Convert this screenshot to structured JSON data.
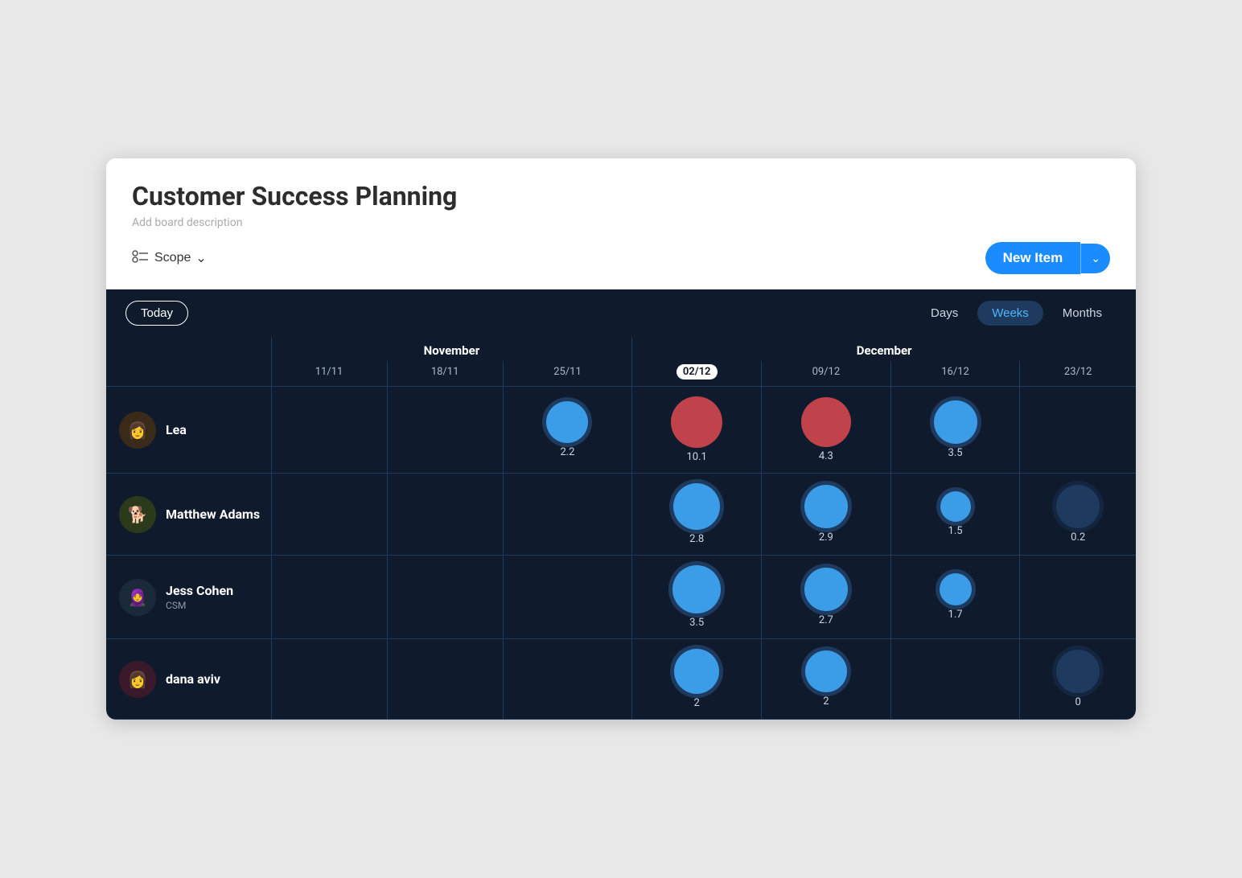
{
  "header": {
    "title": "Customer Success Planning",
    "description": "Add board description",
    "scope_label": "Scope",
    "new_item_label": "New Item"
  },
  "timeline": {
    "today_label": "Today",
    "view_options": [
      "Days",
      "Weeks",
      "Months"
    ],
    "active_view": "Weeks",
    "months": [
      {
        "label": "November",
        "span": 3
      },
      {
        "label": "December",
        "span": 4
      }
    ],
    "dates": [
      "11/11",
      "18/11",
      "25/11",
      "02/12",
      "09/12",
      "16/12",
      "23/12"
    ],
    "current_date": "02/12",
    "people": [
      {
        "name": "Lea",
        "role": "",
        "avatar_emoji": "👩",
        "bubbles": [
          {
            "date_idx": 0,
            "value": null,
            "size": 0,
            "type": ""
          },
          {
            "date_idx": 1,
            "value": null,
            "size": 0,
            "type": ""
          },
          {
            "date_idx": 2,
            "value": 2.2,
            "size": 52,
            "type": "ring"
          },
          {
            "date_idx": 3,
            "value": 10.1,
            "size": 64,
            "type": "red"
          },
          {
            "date_idx": 4,
            "value": 4.3,
            "size": 62,
            "type": "red"
          },
          {
            "date_idx": 5,
            "value": 3.5,
            "size": 54,
            "type": "blue"
          },
          {
            "date_idx": 6,
            "value": null,
            "size": 0,
            "type": ""
          }
        ]
      },
      {
        "name": "Matthew Adams",
        "role": "",
        "avatar_emoji": "🐶",
        "bubbles": [
          {
            "date_idx": 0,
            "value": null,
            "size": 0,
            "type": ""
          },
          {
            "date_idx": 1,
            "value": null,
            "size": 0,
            "type": ""
          },
          {
            "date_idx": 2,
            "value": null,
            "size": 0,
            "type": ""
          },
          {
            "date_idx": 3,
            "value": 2.8,
            "size": 58,
            "type": "ring"
          },
          {
            "date_idx": 4,
            "value": 2.9,
            "size": 54,
            "type": "ring"
          },
          {
            "date_idx": 5,
            "value": 1.5,
            "size": 38,
            "type": "ring"
          },
          {
            "date_idx": 6,
            "value": 0.2,
            "size": 54,
            "type": "dark"
          }
        ]
      },
      {
        "name": "Jess Cohen",
        "role": "CSM",
        "avatar_emoji": "👩‍🦱",
        "bubbles": [
          {
            "date_idx": 0,
            "value": null,
            "size": 0,
            "type": ""
          },
          {
            "date_idx": 1,
            "value": null,
            "size": 0,
            "type": ""
          },
          {
            "date_idx": 2,
            "value": null,
            "size": 0,
            "type": ""
          },
          {
            "date_idx": 3,
            "value": 3.5,
            "size": 60,
            "type": "ring"
          },
          {
            "date_idx": 4,
            "value": 2.7,
            "size": 54,
            "type": "ring"
          },
          {
            "date_idx": 5,
            "value": 1.7,
            "size": 40,
            "type": "ring"
          },
          {
            "date_idx": 6,
            "value": null,
            "size": 0,
            "type": ""
          }
        ]
      },
      {
        "name": "dana aviv",
        "role": "",
        "avatar_emoji": "👩",
        "bubbles": [
          {
            "date_idx": 0,
            "value": null,
            "size": 0,
            "type": ""
          },
          {
            "date_idx": 1,
            "value": null,
            "size": 0,
            "type": ""
          },
          {
            "date_idx": 2,
            "value": null,
            "size": 0,
            "type": ""
          },
          {
            "date_idx": 3,
            "value": 2,
            "size": 56,
            "type": "ring"
          },
          {
            "date_idx": 4,
            "value": 2,
            "size": 52,
            "type": "ring"
          },
          {
            "date_idx": 5,
            "value": null,
            "size": 0,
            "type": ""
          },
          {
            "date_idx": 6,
            "value": 0,
            "size": 54,
            "type": "dark"
          }
        ]
      }
    ]
  },
  "colors": {
    "background": "#0f1b2d",
    "grid_line": "#1e3a5f",
    "accent_blue": "#1a8cff",
    "text_primary": "#ffffff",
    "text_muted": "#aabbcc",
    "bubble_blue": "#3b9de8",
    "bubble_ring": "#1976d2",
    "bubble_red": "#c0424a",
    "bubble_dark": "#1e3a5f"
  }
}
